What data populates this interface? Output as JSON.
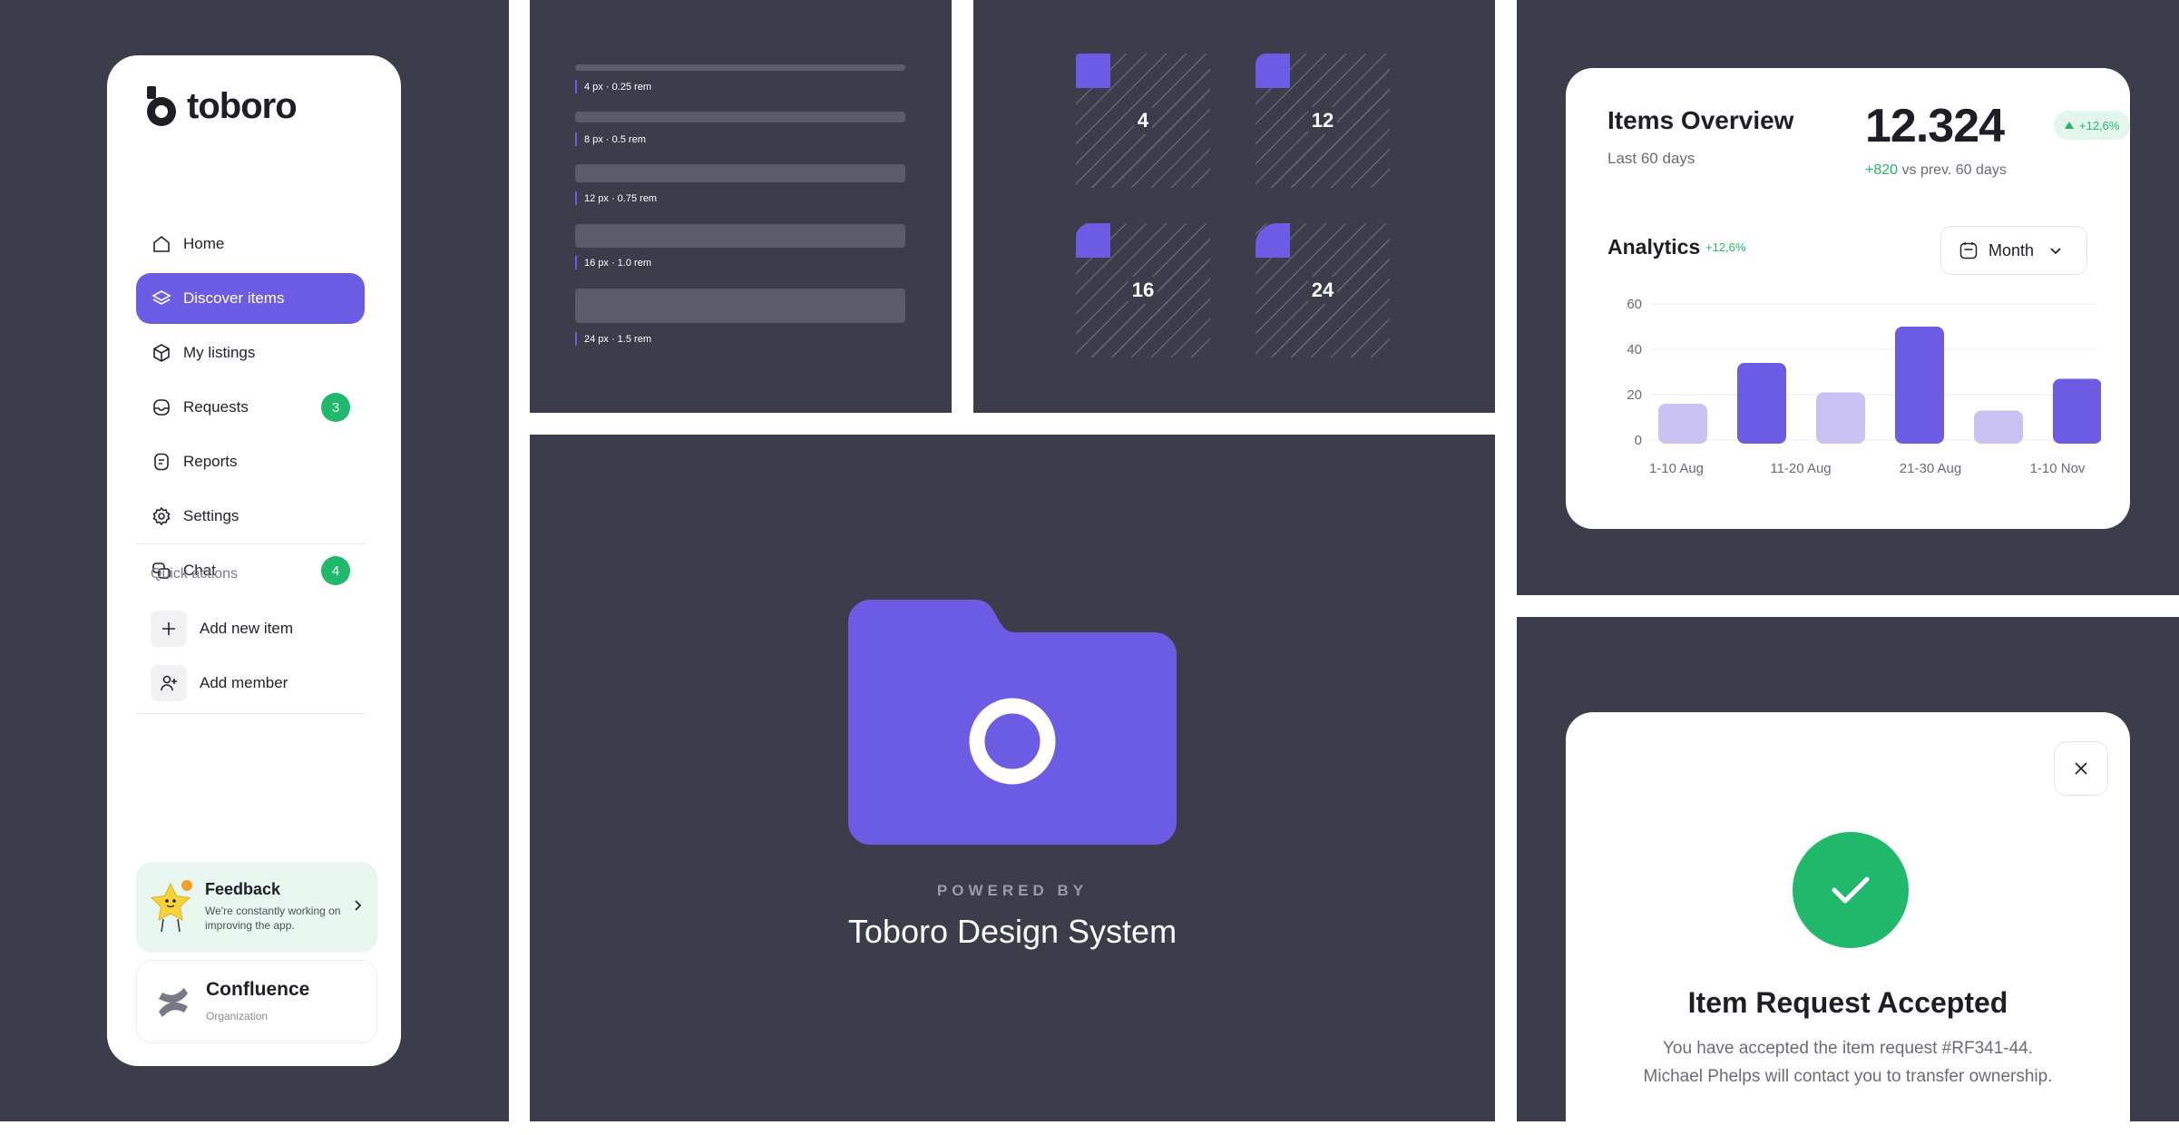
{
  "sidebar": {
    "logo": "toboro",
    "items": [
      {
        "label": "Home",
        "icon": "home-icon"
      },
      {
        "label": "Discover items",
        "icon": "layers-icon",
        "active": true
      },
      {
        "label": "My listings",
        "icon": "box-icon"
      },
      {
        "label": "Requests",
        "icon": "inbox-icon",
        "badge": "3"
      },
      {
        "label": "Reports",
        "icon": "document-icon"
      },
      {
        "label": "Settings",
        "icon": "gear-icon"
      },
      {
        "label": "Chat",
        "icon": "chat-icon",
        "badge": "4"
      }
    ],
    "quick_actions_title": "Quick actions",
    "quick_actions": [
      {
        "label": "Add new item",
        "icon": "plus-icon"
      },
      {
        "label": "Add member",
        "icon": "add-user-icon"
      }
    ],
    "feedback": {
      "title": "Feedback",
      "description": "We're constantly working on improving the app."
    },
    "organization": {
      "name": "Confluence",
      "type": "Organization"
    }
  },
  "spacing": {
    "labels": [
      "4 px · 0.25 rem",
      "8 px · 0.5 rem",
      "12 px · 0.75 rem",
      "16 px · 1.0 rem",
      "24 px · 1.5 rem"
    ]
  },
  "radius": {
    "values": [
      "4",
      "12",
      "16",
      "24"
    ]
  },
  "powered": {
    "caption": "POWERED BY",
    "name": "Toboro Design System"
  },
  "overview": {
    "title": "Items Overview",
    "subtitle": "Last 60 days",
    "value": "12.324",
    "change": "+12,6%",
    "delta_value": "+820",
    "delta_text": "vs prev. 60 days",
    "analytics_title": "Analytics",
    "analytics_change": "+12,6%",
    "period": "Month"
  },
  "chart_data": {
    "type": "bar",
    "title": "Analytics",
    "categories": [
      "1-10 Aug",
      "",
      "11-20 Aug",
      "",
      "21-30 Aug",
      "",
      "1-10 Nov"
    ],
    "values": [
      16,
      34,
      21,
      50,
      13,
      27
    ],
    "x_tick_labels": [
      "1-10 Aug",
      "11-20 Aug",
      "21-30 Aug",
      "1-10 Nov"
    ],
    "y_ticks": [
      "0",
      "20",
      "40",
      "60"
    ],
    "ylim": [
      0,
      60
    ],
    "grid": true,
    "colors": {
      "light": "#c9c2f3",
      "dark": "#6c5ce4"
    }
  },
  "modal": {
    "title": "Item Request Accepted",
    "line1": "You have accepted the item request #RF341-44.",
    "line2": "Michael Phelps will contact you to transfer ownership."
  },
  "colors": {
    "accent": "#6c5ce4",
    "success": "#20b86a",
    "panel": "#3c3d4b"
  }
}
